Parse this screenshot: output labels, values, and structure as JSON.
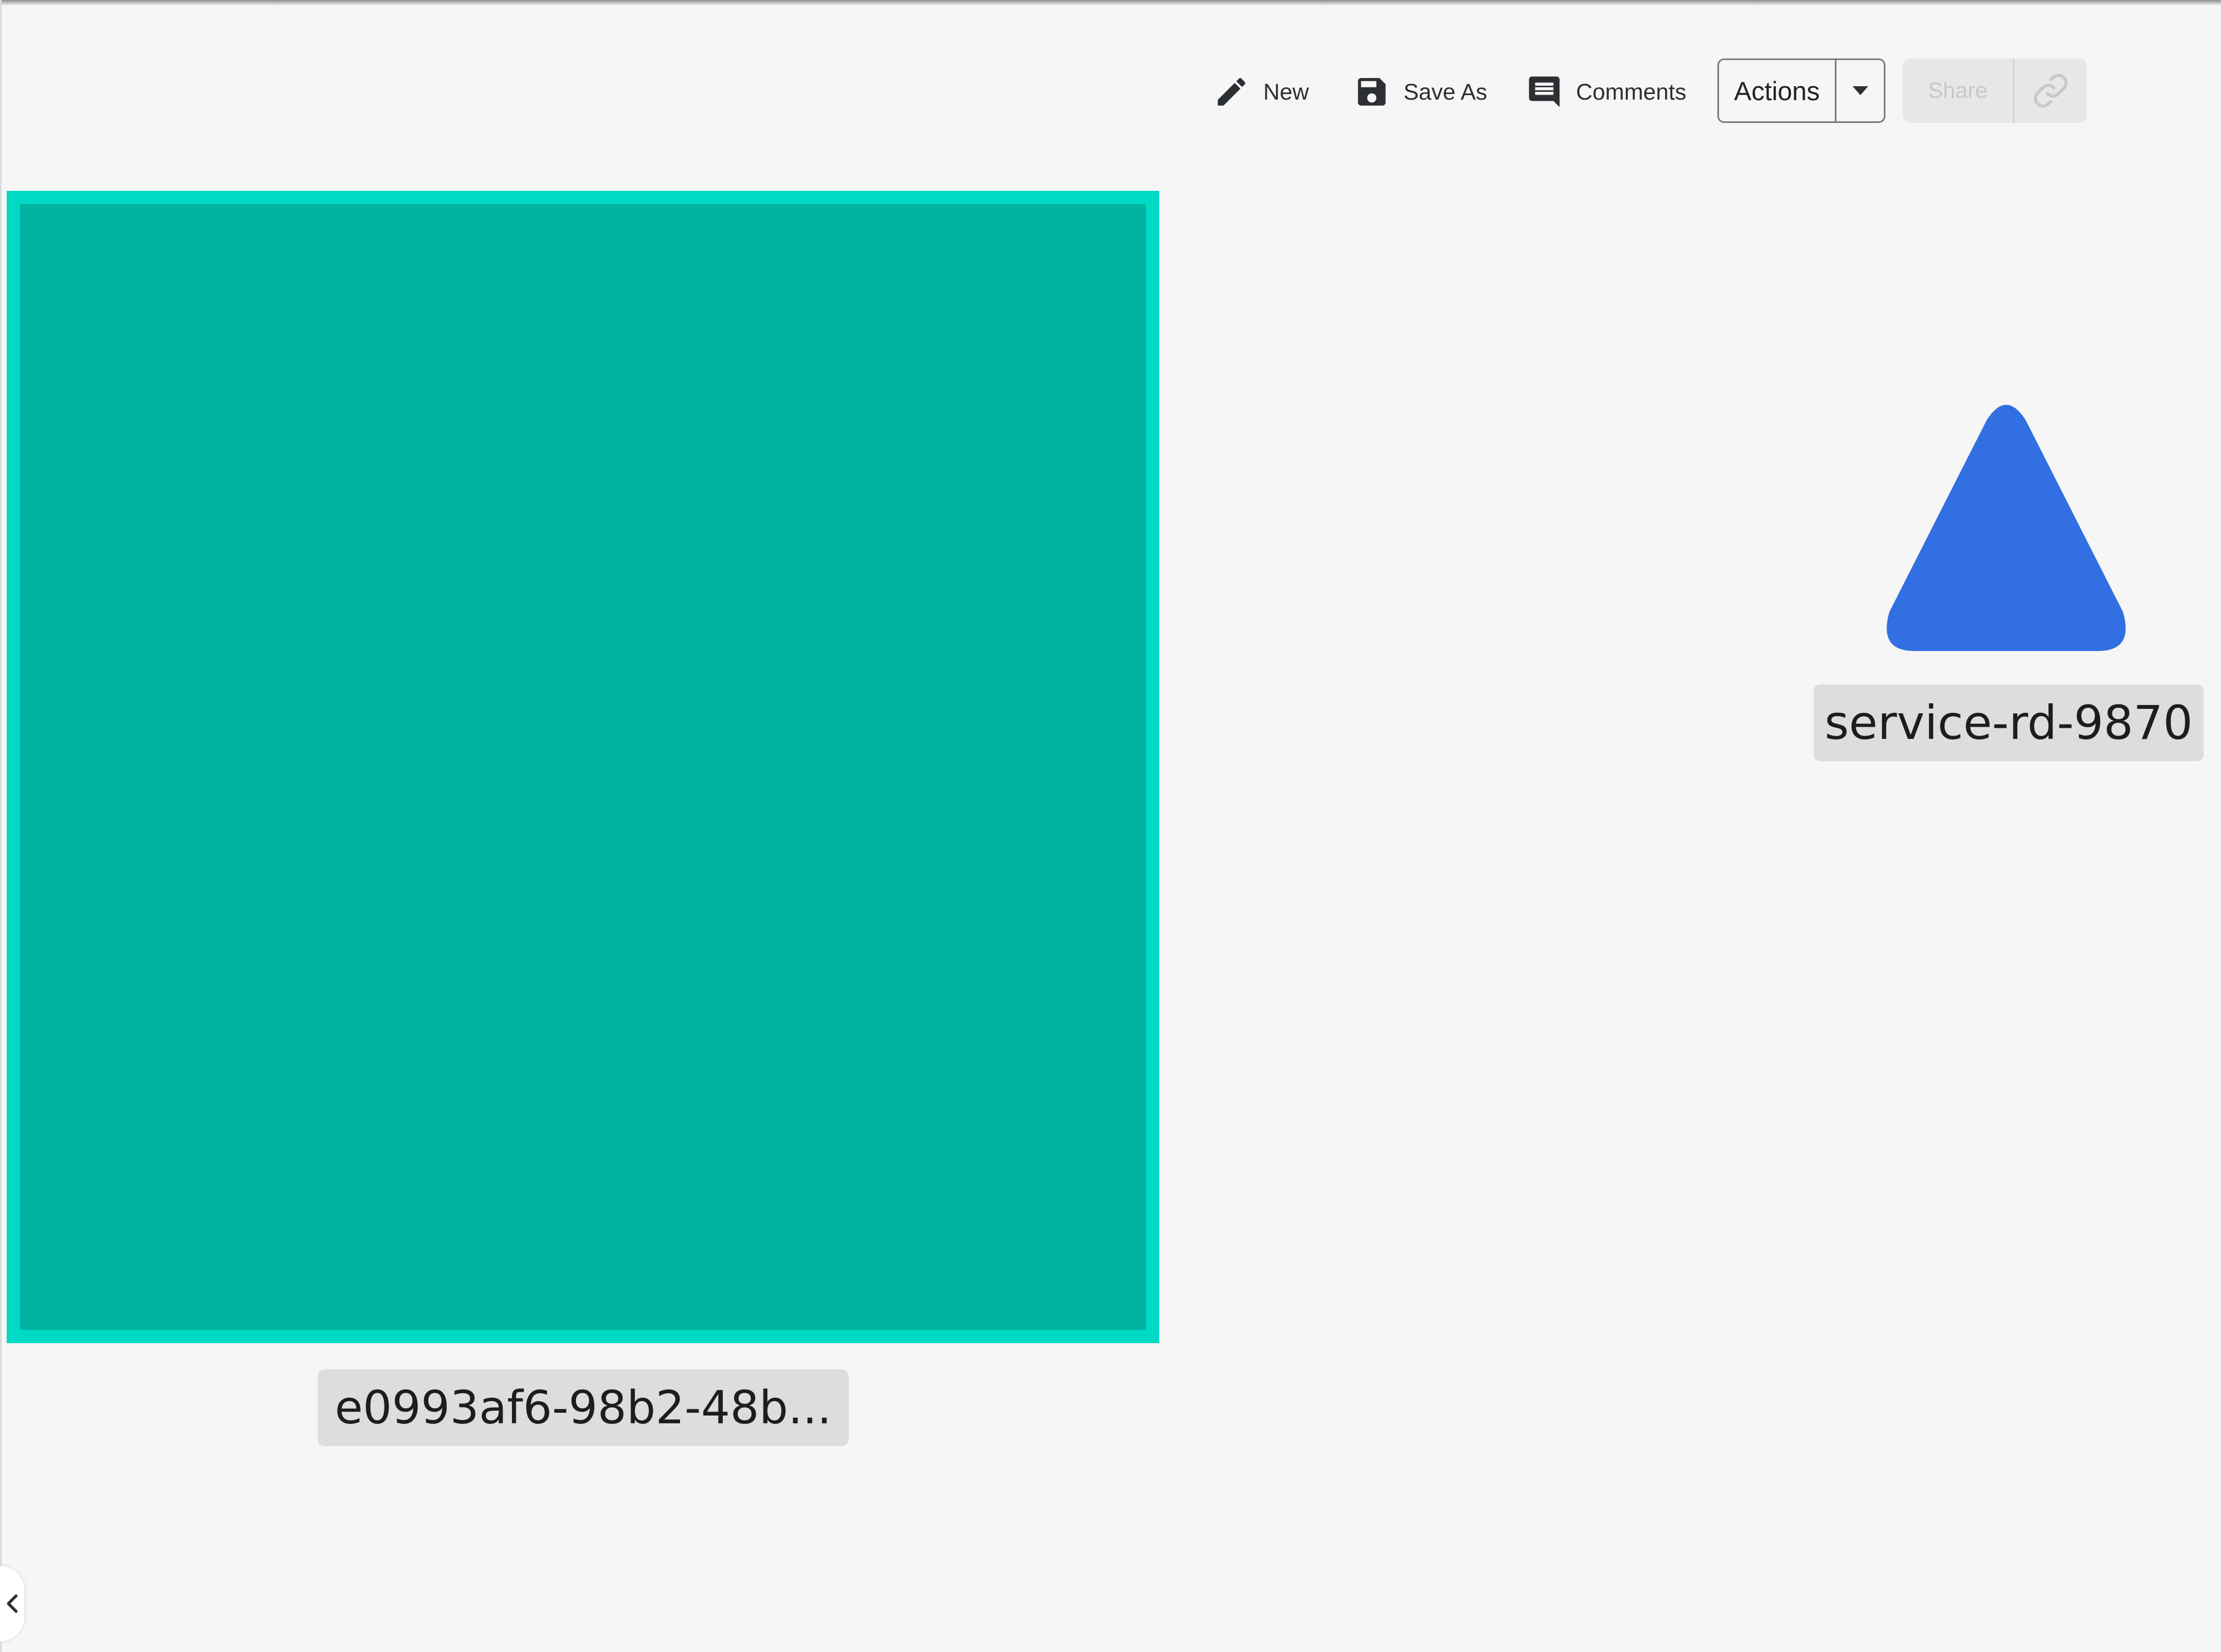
{
  "toolbar": {
    "new_label": "New",
    "save_as_label": "Save As",
    "comments_label": "Comments",
    "actions_label": "Actions",
    "share_label": "Share",
    "icons": {
      "new": "pencil-icon",
      "save_as": "floppy-disk-icon",
      "comments": "comment-icon",
      "actions_dropdown": "caret-down-icon",
      "copy_link": "link-icon"
    }
  },
  "canvas": {
    "nodes": [
      {
        "shape": "square",
        "label": "e0993af6-98b2-48b...",
        "fill_color": "#00b3a1",
        "border_color": "#00d9c3",
        "selected": true
      },
      {
        "shape": "triangle",
        "label": "service-rd-9870",
        "fill_color": "#316fe2"
      }
    ]
  },
  "panel_toggle": {
    "icon": "chevron-left-icon"
  }
}
